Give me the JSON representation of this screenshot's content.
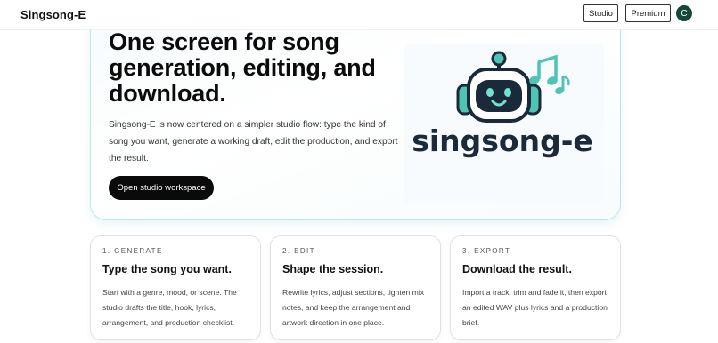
{
  "header": {
    "brand": "Singsong-E",
    "studio_label": "Studio",
    "premium_label": "Premium",
    "avatar_initial": "C"
  },
  "hero": {
    "title": "One screen for song generation, editing, and download.",
    "description": "Singsong-E is now centered on a simpler studio flow: type the kind of song you want, generate a working draft, edit the production, and export the result.",
    "cta_label": "Open studio workspace",
    "logo_text": "singsong-e",
    "logo_icon": "robot-headphones-music-notes-icon"
  },
  "cards": [
    {
      "step": "1. GENERATE",
      "title": "Type the song you want.",
      "body": "Start with a genre, mood, or scene. The studio drafts the title, hook, lyrics, arrangement, and production checklist."
    },
    {
      "step": "2. EDIT",
      "title": "Shape the session.",
      "body": "Rewrite lyrics, adjust sections, tighten mix notes, and keep the arrangement and artwork direction in one place."
    },
    {
      "step": "3. EXPORT",
      "title": "Download the result.",
      "body": "Import a track, trim and fade it, then export an edited WAV plus lyrics and a production brief."
    }
  ],
  "colors": {
    "accent_teal": "#4fc3b4",
    "dark_navy": "#1b2a3a",
    "avatar_green": "#14463a",
    "hero_border": "#bfe6ea"
  }
}
